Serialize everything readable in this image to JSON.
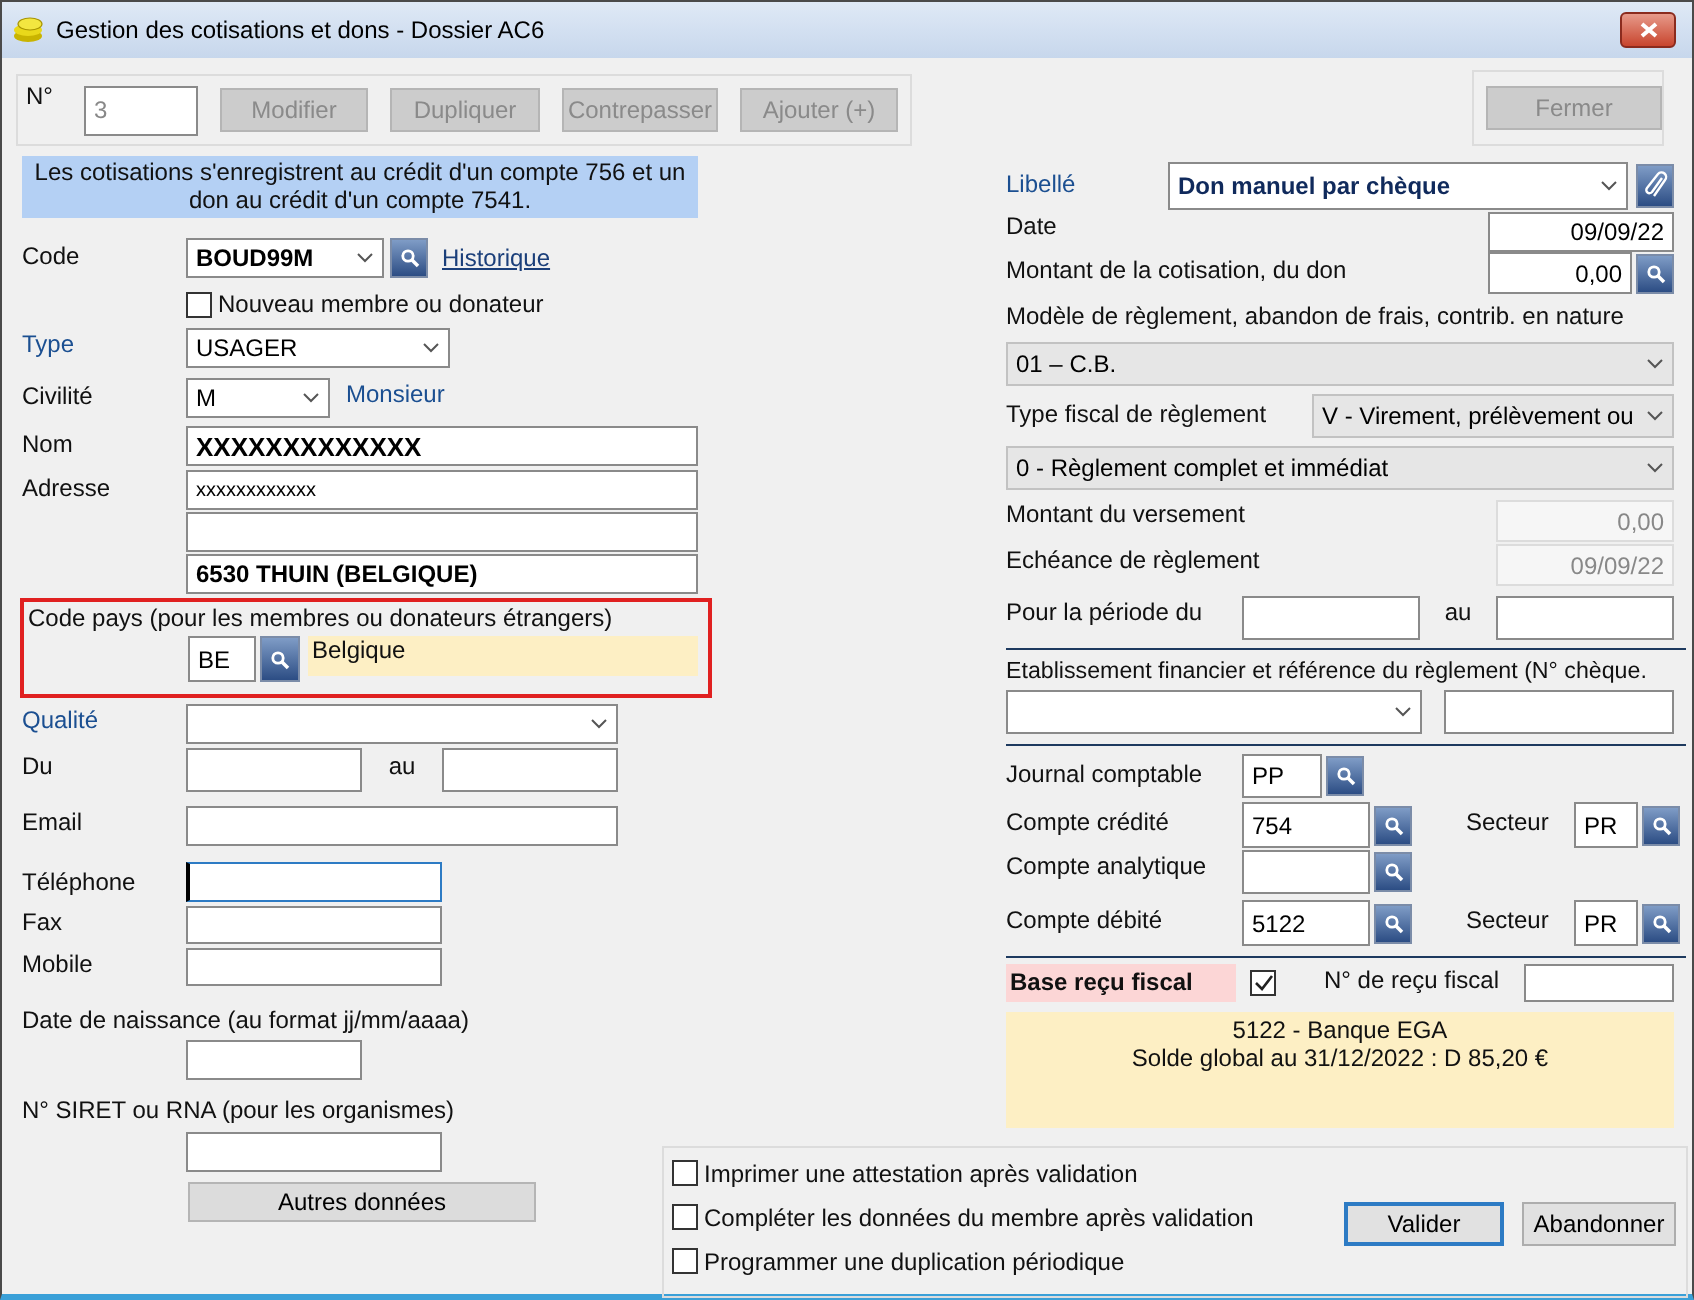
{
  "window": {
    "title": "Gestion des cotisations et dons - Dossier AC6"
  },
  "toolbar": {
    "number_label": "N°",
    "number_value": "3",
    "buttons": [
      {
        "label": "Modifier",
        "disabled": true
      },
      {
        "label": "Dupliquer",
        "disabled": true
      },
      {
        "label": "Contrepasser",
        "disabled": true
      },
      {
        "label": "Ajouter (+)",
        "disabled": true
      }
    ],
    "close_button": {
      "label": "Fermer",
      "disabled": true
    }
  },
  "info_banner": "Les cotisations s'enregistrent au crédit d'un compte 756 et un don au crédit d'un compte 7541.",
  "member": {
    "code": {
      "label": "Code",
      "value": "BOUD99M",
      "link": "Historique"
    },
    "new_member": {
      "label": "Nouveau membre ou donateur",
      "checked": false
    },
    "type": {
      "label": "Type",
      "value": "USAGER",
      "accent": true
    },
    "civility": {
      "label": "Civilité",
      "value": "M",
      "description": "Monsieur"
    },
    "name": {
      "label": "Nom",
      "value": "XXXXXXXXXXXXX"
    },
    "address": {
      "label": "Adresse",
      "line_1": "xxxxxxxxxxxx",
      "line_3": "6530 THUIN (BELGIQUE)"
    },
    "country": {
      "label": "Code pays (pour les membres ou donateurs étrangers)",
      "code": "BE",
      "name": "Belgique",
      "highlighted": true
    },
    "quality": {
      "label": "Qualité",
      "accent": true
    },
    "period": {
      "label": "Du",
      "to_label": "au"
    },
    "email": {
      "label": "Email"
    },
    "phone": {
      "label": "Téléphone",
      "focused": true
    },
    "fax": {
      "label": "Fax"
    },
    "mobile": {
      "label": "Mobile"
    },
    "birth_date": {
      "label": "Date de naissance (au format jj/mm/aaaa)"
    },
    "siret": {
      "label": "N° SIRET ou RNA (pour les organismes)"
    },
    "more_button": "Autres données"
  },
  "payment": {
    "title_field": {
      "label": "Libellé",
      "value": "Don manuel par chèque",
      "accent": true
    },
    "date": {
      "label": "Date",
      "value": "09/09/22"
    },
    "amount": {
      "label": "Montant de la cotisation, du don",
      "value": "0,00"
    },
    "model": {
      "label": "Modèle de règlement, abandon de frais, contrib. en nature",
      "value": "01 – C.B."
    },
    "fiscal_type": {
      "label": "Type fiscal de règlement",
      "value": "V - Virement, prélèvement ou"
    },
    "settlement": {
      "value": "0 - Règlement complet et immédiat"
    },
    "paid_amount": {
      "label": "Montant du versement",
      "value": "0,00",
      "disabled": true
    },
    "due_date": {
      "label": "Echéance de règlement",
      "value": "09/09/22",
      "disabled": true
    },
    "period": {
      "label": "Pour la période du",
      "to_label": "au"
    },
    "bank_reference": {
      "label": "Etablissement financier et référence du règlement (N° chèque."
    }
  },
  "accounting": {
    "journal": {
      "label": "Journal comptable",
      "value": "PP"
    },
    "credit_account": {
      "label": "Compte crédité",
      "value": "754",
      "sector_label": "Secteur",
      "sector": "PR"
    },
    "analytic_account": {
      "label": "Compte analytique"
    },
    "debit_account": {
      "label": "Compte débité",
      "value": "5122",
      "sector_label": "Secteur",
      "sector": "PR"
    },
    "tax_receipt": {
      "label": "Base reçu fiscal",
      "checked": true,
      "number_label": "N° de reçu fiscal"
    },
    "summary": [
      "5122 - Banque EGA",
      "Solde global au 31/12/2022 : D 85,20 €"
    ]
  },
  "options": [
    {
      "label": "Imprimer une attestation après validation",
      "checked": false
    },
    {
      "label": "Compléter les données du membre après validation",
      "checked": false
    },
    {
      "label": "Programmer une duplication périodique",
      "checked": false
    }
  ],
  "actions": [
    {
      "label": "Valider",
      "default": true
    },
    {
      "label": "Abandonner",
      "default": false
    }
  ]
}
